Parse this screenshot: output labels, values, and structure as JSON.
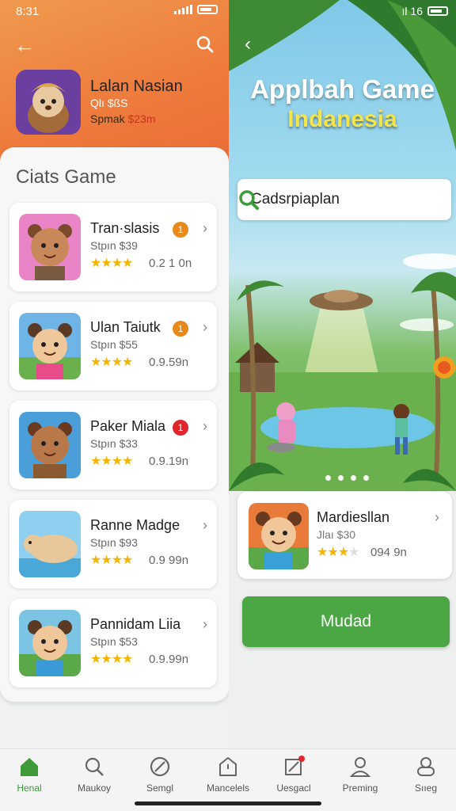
{
  "status_bar": {
    "time": "8:31",
    "right_signal_text": "ıl 16"
  },
  "left_panel": {
    "hero": {
      "title": "Lalan Nasian",
      "subtitle": "Qlı $ßS",
      "price_label": "Spmak",
      "price_value": "$23m"
    },
    "list_title": "Ciats Game",
    "games": [
      {
        "name": "Tran·slasis",
        "price": "Stpın $39",
        "stars": "★★★★",
        "rating": "0.2 1 0n",
        "badge": "1",
        "badge_color": "#e8891a"
      },
      {
        "name": "Ulan Taiutk",
        "price": "Stpın $55",
        "stars": "★★★★",
        "rating": "0.9.59n",
        "badge": "1",
        "badge_color": "#e8891a"
      },
      {
        "name": "Paker Miala",
        "price": "Stpın $33",
        "stars": "★★★★",
        "rating": "0.9.19n",
        "badge": "1",
        "badge_color": "#e0262c"
      },
      {
        "name": "Ranne Madge",
        "price": "Stpın $93",
        "stars": "★★★★",
        "rating": "0.9 99n",
        "badge": "",
        "badge_color": ""
      },
      {
        "name": "Pannidam Liia",
        "price": "Stpın $53",
        "stars": "★★★★",
        "rating": "0.9.99n",
        "badge": "",
        "badge_color": ""
      }
    ]
  },
  "right_panel": {
    "banner_title": "Applbah Game",
    "banner_subtitle": "Indanesia",
    "search_text": "Cadsrpiaplan",
    "feature": {
      "name": "Mardiesllan",
      "price": "Jlaı $30",
      "stars_on": "★★★",
      "stars_off": "★",
      "rating": "094 9n"
    },
    "main_button": "Mudad"
  },
  "bottom_nav": [
    {
      "label": "Henal",
      "icon": "home-icon",
      "active": true
    },
    {
      "label": "Maukoy",
      "icon": "search-icon",
      "active": false
    },
    {
      "label": "Semgl",
      "icon": "compass-icon",
      "active": false
    },
    {
      "label": "Mancelels",
      "icon": "shop-icon",
      "active": false
    },
    {
      "label": "Uesgacl",
      "icon": "edit-icon",
      "active": false
    },
    {
      "label": "Preming",
      "icon": "profile-icon",
      "active": false
    },
    {
      "label": "Sııeg",
      "icon": "settings-icon",
      "active": false
    }
  ],
  "colors": {
    "accent_orange": "#ee7a3c",
    "accent_green": "#4aa744",
    "star": "#f5b400"
  }
}
